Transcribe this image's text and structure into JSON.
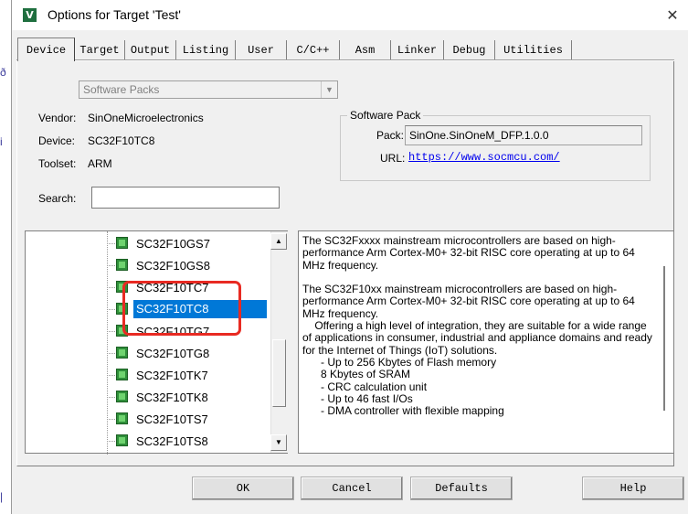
{
  "window": {
    "title": "Options for Target 'Test'",
    "app_icon": "keil-uvision-icon",
    "close_glyph": "✕"
  },
  "tabs": [
    {
      "label": "Device",
      "active": true
    },
    {
      "label": "Target"
    },
    {
      "label": "Output"
    },
    {
      "label": "Listing"
    },
    {
      "label": "User"
    },
    {
      "label": "C/C++"
    },
    {
      "label": "Asm"
    },
    {
      "label": "Linker"
    },
    {
      "label": "Debug"
    },
    {
      "label": "Utilities"
    }
  ],
  "device": {
    "pack_select": "Software Packs",
    "vendor_label": "Vendor:",
    "vendor": "SinOneMicroelectronics",
    "device_label": "Device:",
    "device": "SC32F10TC8",
    "toolset_label": "Toolset:",
    "toolset": "ARM",
    "search_label": "Search:",
    "search_value": ""
  },
  "software_pack": {
    "title": "Software Pack",
    "pack_label": "Pack:",
    "pack": "SinOne.SinOneM_DFP.1.0.0",
    "url_label": "URL:",
    "url": "https://www.socmcu.com/"
  },
  "device_list": [
    {
      "name": "SC32F10GS7"
    },
    {
      "name": "SC32F10GS8"
    },
    {
      "name": "SC32F10TC7"
    },
    {
      "name": "SC32F10TC8",
      "selected": true
    },
    {
      "name": "SC32F10TG7"
    },
    {
      "name": "SC32F10TG8"
    },
    {
      "name": "SC32F10TK7"
    },
    {
      "name": "SC32F10TK8"
    },
    {
      "name": "SC32F10TS7"
    },
    {
      "name": "SC32F10TS8"
    }
  ],
  "description": "The SC32Fxxxx mainstream microcontrollers are based on high-performance Arm Cortex-M0+ 32-bit RISC core operating at up to 64 MHz frequency.\n\nThe SC32F10xx mainstream microcontrollers are based on high-performance Arm Cortex-M0+ 32-bit RISC core operating at up to 64 MHz frequency.\n    Offering a high level of integration, they are suitable for a wide range of applications in consumer, industrial and appliance domains and ready for the Internet of Things (IoT) solutions.\n      - Up to 256 Kbytes of Flash memory\n      8 Kbytes of SRAM\n      - CRC calculation unit\n      - Up to 46 fast I/Os\n      - DMA controller with flexible mapping",
  "buttons": {
    "ok": "OK",
    "cancel": "Cancel",
    "defaults": "Defaults",
    "help": "Help"
  },
  "colors": {
    "selection": "#0078d7",
    "highlight_box": "#e82a22",
    "link": "#0000ee"
  }
}
